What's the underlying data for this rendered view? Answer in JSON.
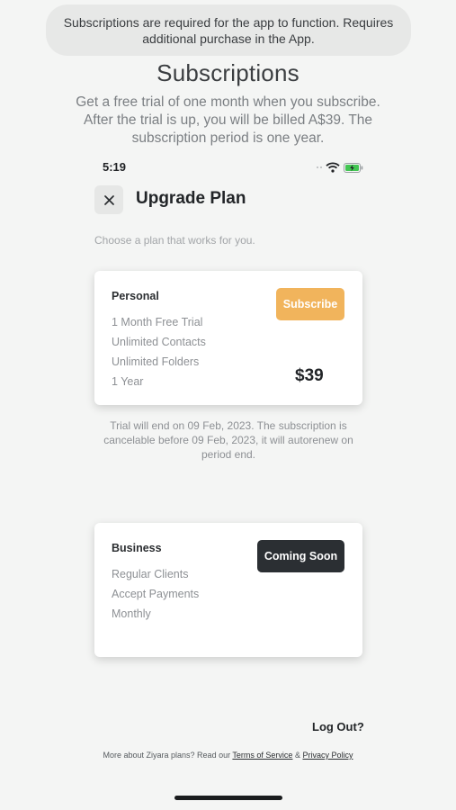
{
  "banner": {
    "text": "Subscriptions are required for the app to function. Requires additional purchase in the App."
  },
  "header": {
    "title": "Subscriptions",
    "description": "Get a free trial of one month when you subscribe. After the trial is up, you will be billed A$39. The subscription period is one year."
  },
  "status_bar": {
    "time": "5:19",
    "icons": [
      "signal-dots-icon",
      "wifi-icon",
      "battery-charging-icon"
    ]
  },
  "upgrade": {
    "close_icon": "close-icon",
    "title": "Upgrade Plan",
    "subtitle": "Choose a plan that works for you."
  },
  "plans": {
    "personal": {
      "name": "Personal",
      "features": [
        "1 Month Free Trial",
        "Unlimited Contacts",
        "Unlimited Folders",
        "1 Year"
      ],
      "button_label": "Subscribe",
      "button_color": "#f1b45c",
      "price": "$39"
    },
    "business": {
      "name": "Business",
      "features": [
        "Regular Clients",
        "Accept Payments",
        "Monthly"
      ],
      "button_label": "Coming Soon",
      "button_color": "#2b2f33"
    }
  },
  "trial_note": "Trial will end on 09 Feb, 2023. The subscription is cancelable before 09 Feb, 2023, it will autorenew on period end.",
  "logout_label": "Log Out?",
  "footer": {
    "prefix": "More about Ziyara plans? Read our ",
    "terms": "Terms of Service",
    "separator": " & ",
    "privacy": "Privacy Policy"
  }
}
